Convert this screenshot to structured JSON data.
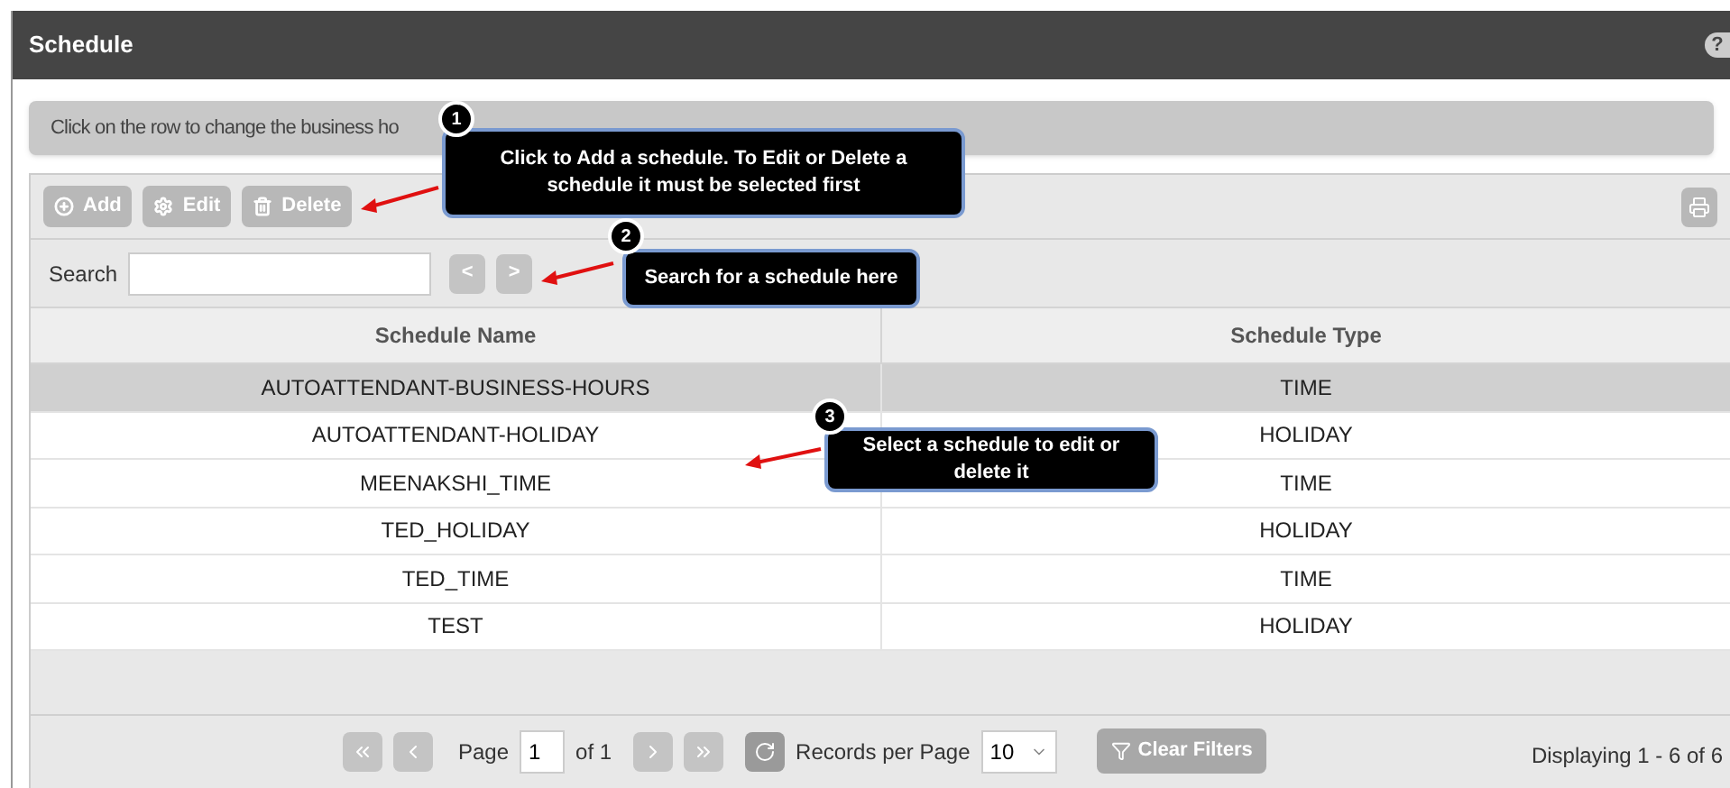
{
  "window": {
    "title": "Schedule",
    "help": "?"
  },
  "banner": "Click on the row to change the business ho",
  "toolbar": {
    "buttons": [
      {
        "kind": "add",
        "label": "Add"
      },
      {
        "kind": "edit",
        "label": "Edit"
      },
      {
        "kind": "delete",
        "label": "Delete"
      }
    ]
  },
  "search": {
    "label": "Search",
    "prev": "<",
    "next": ">"
  },
  "table": {
    "columns": [
      "Schedule Name",
      "Schedule Type"
    ],
    "rows": [
      {
        "name": "AUTOATTENDANT-BUSINESS-HOURS",
        "type": "TIME",
        "selected": true
      },
      {
        "name": "AUTOATTENDANT-HOLIDAY",
        "type": "HOLIDAY",
        "selected": false
      },
      {
        "name": "MEENAKSHI_TIME",
        "type": "TIME",
        "selected": false
      },
      {
        "name": "TED_HOLIDAY",
        "type": "HOLIDAY",
        "selected": false
      },
      {
        "name": "TED_TIME",
        "type": "TIME",
        "selected": false
      },
      {
        "name": "TEST",
        "type": "HOLIDAY",
        "selected": false
      }
    ]
  },
  "pager": {
    "page_label": "Page",
    "page": "1",
    "of": "of 1",
    "records_label": "Records per Page",
    "records": "10",
    "clear_filters": "Clear Filters",
    "displaying": "Displaying 1 - 6 of 6"
  },
  "callouts": [
    {
      "number": "1",
      "text": "Click to Add a schedule.  To Edit or Delete a schedule it must be selected first"
    },
    {
      "number": "2",
      "text": "Search for a schedule here"
    },
    {
      "number": "3",
      "text": "Select a schedule to edit or delete it"
    }
  ]
}
